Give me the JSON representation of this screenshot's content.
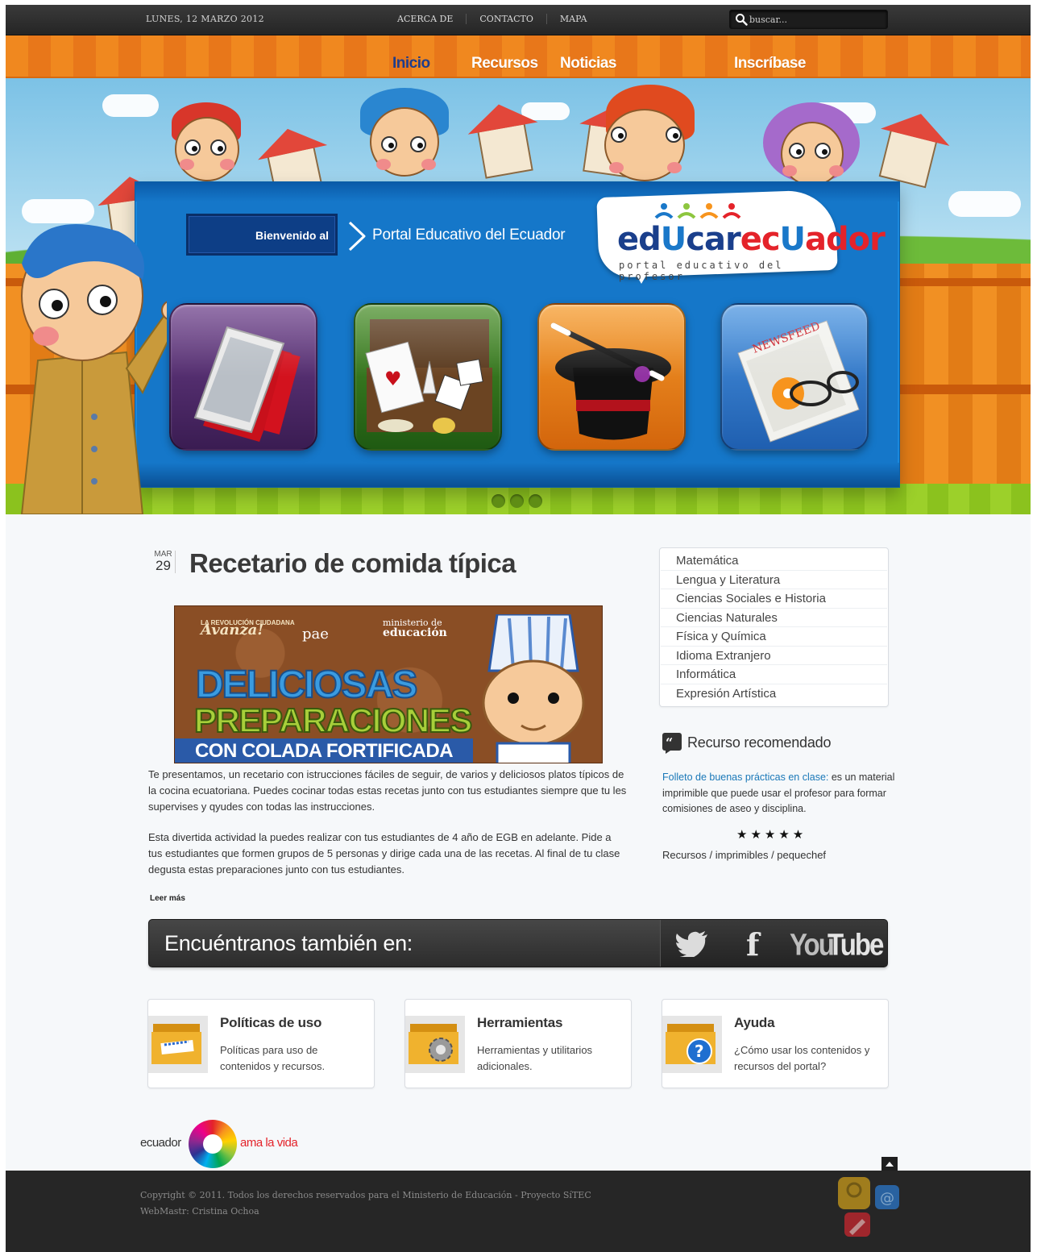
{
  "topbar": {
    "date": "LUNES, 12 MARZO 2012",
    "links": [
      "ACERCA DE",
      "CONTACTO",
      "MAPA"
    ],
    "search_placeholder": "buscar..."
  },
  "nav": {
    "items": [
      "Inicio",
      "Recursos",
      "Noticias",
      "Inscríbase"
    ],
    "active": "Inicio"
  },
  "hero": {
    "welcome": "Bienvenido al",
    "portal": "Portal Educativo del Ecuador",
    "logo_word": "edUcarecUador",
    "logo_sub": "portal educativo del profesor",
    "tiles": [
      "video-icon",
      "games-icon",
      "magic-hat-icon",
      "newsfeed-icon"
    ],
    "slides": 3
  },
  "article": {
    "month": "MAR",
    "day": "29",
    "title": "Recetario de comida típica",
    "banner": {
      "tag1": "LA REVOLUCIÓN CIUDADANA",
      "tag2": "Avanza!",
      "pae": "pae",
      "ministry1": "ministerio de",
      "ministry2": "educación",
      "line1": "DELICIOSAS",
      "line2": "PREPARACIONES",
      "line3": "CON COLADA FORTIFICADA"
    },
    "p1": "Te presentamos, un recetario con istrucciones fáciles de seguir, de varios y deliciosos platos típicos de la cocina ecuatoriana. Puedes cocinar todas estas recetas junto con tus estudiantes siempre que tu les supervises y qyudes con todas las instrucciones.",
    "p2": "Esta divertida actividad la puedes realizar con tus estudiantes de 4 año de EGB en adelante. Pide a tus estudiantes que formen grupos de 5 personas y dirige cada una de las recetas. Al final de tu clase degusta estas preparaciones junto con tus estudiantes.",
    "more": "Leer más"
  },
  "sidebar": {
    "subjects": [
      "Matemática",
      "Lengua y Literatura",
      "Ciencias Sociales e Historia",
      "Ciencias Naturales",
      "Física y Química",
      "Idioma Extranjero",
      "Informática",
      "Expresión Artística"
    ],
    "rec_title": "Recurso recomendado",
    "rec_link": "Folleto de buenas prácticas en clase:",
    "rec_text": " es un material imprimible que puede usar el profesor para formar comisiones de aseo y disciplina.",
    "rating": 5,
    "stars": "★★★★★",
    "rec_path": "Recursos / imprimibles / pequechef"
  },
  "social": {
    "label": "Encuéntranos también en:",
    "facebook": "f",
    "youtube_you": "You",
    "youtube_tube": "Tube"
  },
  "cards": [
    {
      "title": "Políticas de uso",
      "text": "Políticas para uso de contenidos y recursos."
    },
    {
      "title": "Herramientas",
      "text": "Herramientas y utilitarios adicionales."
    },
    {
      "title": "Ayuda",
      "text": "¿Cómo usar los contenidos y recursos del portal?"
    }
  ],
  "footer": {
    "logo_left": "ecuador",
    "logo_right": "ama la vida",
    "copyright": "Copyright © 2011. Todos los derechos reservados para el Ministerio de Educación - Proyecto SíTEC",
    "webmaster": "WebMastr: Cristina Ochoa"
  },
  "colors": {
    "nav_orange": "#f0881f",
    "nav_active": "#1e3d8c",
    "board_blue": "#1577c9",
    "link_blue": "#1a78b8",
    "footer_dark": "#262626"
  }
}
